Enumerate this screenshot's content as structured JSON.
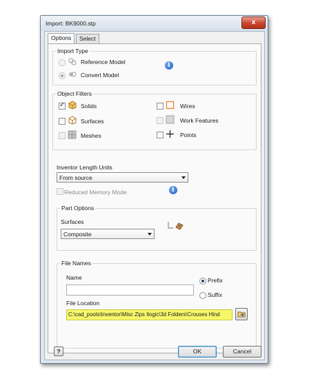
{
  "window": {
    "title": "Import:  BK9000.stp",
    "close_label": "x"
  },
  "tabs": [
    {
      "label": "Options"
    },
    {
      "label": "Select"
    }
  ],
  "import_type": {
    "label": "Import Type",
    "options": [
      {
        "label": "Reference Model",
        "selected": false,
        "enabled": false
      },
      {
        "label": "Convert Model",
        "selected": true,
        "enabled": false
      }
    ]
  },
  "object_filters": {
    "label": "Object Filters",
    "items": [
      {
        "label": "Solids",
        "checked": true,
        "icon": "solid-cube-icon"
      },
      {
        "label": "Surfaces",
        "checked": false,
        "icon": "surface-cube-icon"
      },
      {
        "label": "Meshes",
        "checked": false,
        "enabled": false,
        "icon": "mesh-icon"
      },
      {
        "label": "Wires",
        "checked": false,
        "icon": "wire-square-icon"
      },
      {
        "label": "Work Features",
        "checked": false,
        "enabled": false,
        "icon": "work-features-icon"
      },
      {
        "label": "Points",
        "checked": false,
        "icon": "point-cross-icon"
      }
    ]
  },
  "length_units": {
    "label": "Inventor Length Units",
    "value": "From source"
  },
  "reduced_memory": {
    "label": "Reduced Memory Mode",
    "checked": false,
    "enabled": false
  },
  "part_options": {
    "label": "Part Options",
    "surfaces_label": "Surfaces",
    "surfaces_value": "Composite"
  },
  "file_names": {
    "label": "File Names",
    "name_label": "Name",
    "name_value": "",
    "prefix_label": "Prefix",
    "suffix_label": "Suffix",
    "naming": "Prefix",
    "location_label": "File Location",
    "location_value": "C:\\cad_pools\\Inventor\\Misc Zips Ilogic\\3d Folders\\Crouses Hind"
  },
  "buttons": {
    "help": "?",
    "ok": "OK",
    "cancel": "Cancel"
  },
  "colors": {
    "highlight": "#f7f76a",
    "info": "#1f5fc2",
    "wires_icon": "#e8862a"
  }
}
